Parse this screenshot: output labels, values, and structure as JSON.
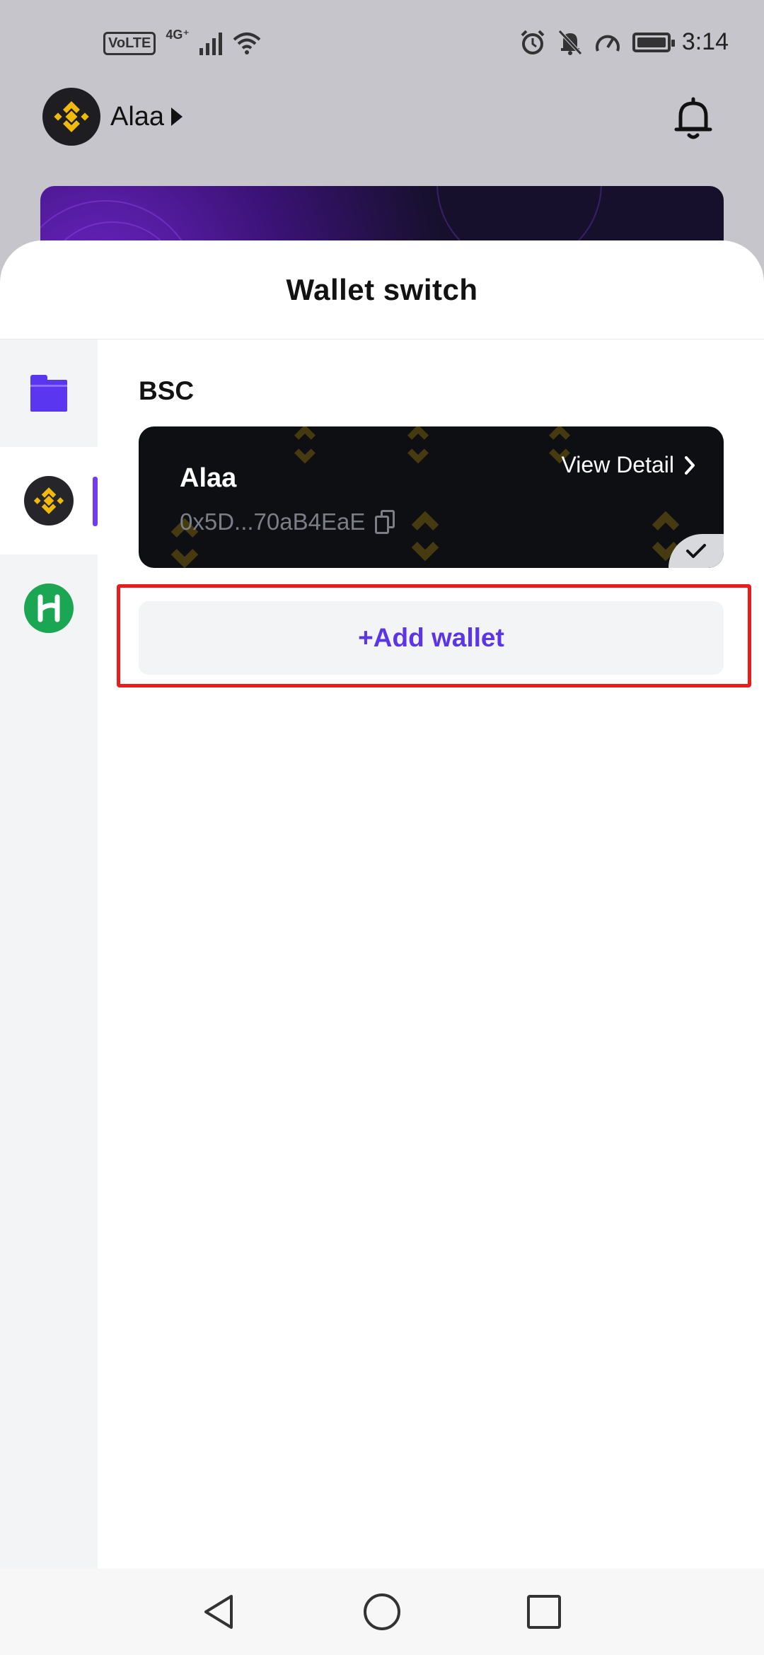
{
  "status_bar": {
    "time": "3:14",
    "volte": "VoLTE",
    "network": "4G⁺",
    "icons": [
      "signal-icon",
      "wifi-icon",
      "alarm-icon",
      "mute-icon",
      "speed-icon",
      "battery-icon"
    ]
  },
  "background_app": {
    "account_name": "Alaa",
    "icons": [
      "bnb-logo-icon",
      "caret-right-icon",
      "bell-icon"
    ]
  },
  "sheet": {
    "title": "Wallet switch",
    "chains": [
      {
        "name": "all-wallets",
        "icon": "folder-icon",
        "active": false
      },
      {
        "name": "bsc",
        "icon": "bnb-logo-icon",
        "active": true
      },
      {
        "name": "heco",
        "icon": "heco-logo-icon",
        "active": false
      }
    ],
    "section_label": "BSC",
    "wallet": {
      "name": "Alaa",
      "address": "0x5D...70aB4EaE",
      "view_detail": "View Detail",
      "selected": true
    },
    "add_wallet_label": "+Add wallet"
  },
  "colors": {
    "accent": "#5c35e6",
    "highlight": "#ec1c1c",
    "card_bg": "#0d0f12",
    "bnb_gold": "#f0b90b",
    "heco_green": "#1aa652"
  },
  "nav_bar": {
    "icons": [
      "back-icon",
      "home-icon",
      "recents-icon"
    ]
  }
}
